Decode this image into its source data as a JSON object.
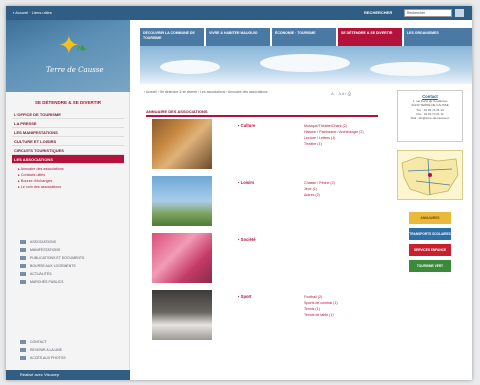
{
  "topbar": {
    "home": "▪ Accueil · Liens utiles",
    "search_label": "RECHERCHER",
    "search_value": "Rechercher"
  },
  "logo": {
    "wordmark": "Terre de Causse"
  },
  "sidebar": {
    "section_title": "SE DÉTENDRE & SE DIVERTIR",
    "menu": [
      "L'OFFICE DE TOURISME",
      "LA PRESSE",
      "LES MANIFESTATIONS",
      "CULTURE ET LOISIRS",
      "CIRCUITS TOURISTIQUES",
      "LES ASSOCIATIONS"
    ],
    "submenu": [
      "▸ Annuaire des associations",
      "▸ Contacts utiles",
      "▸ Bourse d'échanges",
      "▸ Le coin des associations"
    ],
    "links": [
      "ASSOCIATIONS",
      "MANIFESTATIONS",
      "PUBLICATIONS ET DOCUMENTS",
      "BOURSE AUX LOGEMENTS",
      "ACTUALITÉS",
      "MARCHÉS PUBLICS"
    ],
    "links2": [
      "CONTACT",
      "REVENIR A LA UNE",
      "ACCÈS AUX PHOTOS"
    ],
    "footer": "Réalisé avec Visuwep"
  },
  "nav": {
    "tabs": [
      "DÉCOUVRIR LA COMMUNE DE TOURISME",
      "VIVRE & HABITER MAUGUIO",
      "ÉCONOMIE · TOURISME",
      "SE DÉTENDRE & SE DIVERTIR",
      "LES ORGANISMES"
    ]
  },
  "main": {
    "breadcrumb": "› Accueil › Se détendre & se divertir › Les associations › Annuaire des associations",
    "tools": "A- · A A+ ⎙",
    "section_title": "ANNUAIRE DES ASSOCIATIONS",
    "categories": [
      {
        "name": "▪ Culture",
        "items": [
          "Musique/Théâtre/Chant (2)",
          "Histoire / Patrimoine / Archéologie (2)",
          "Lecture / Lettres (1)",
          "Théâtre (1)"
        ]
      },
      {
        "name": "▪ Loisirs",
        "items": [
          "Chasse / Pêche (2)",
          "Jeux (1)",
          "Autres (2)"
        ]
      },
      {
        "name": "▪ Société",
        "items": []
      },
      {
        "name": "▪ Sport",
        "items": [
          "Football (2)",
          "Sports de combat (1)",
          "Tennis (1)",
          "Tennis de table (1)"
        ]
      }
    ]
  },
  "right": {
    "contact_title": "Contact",
    "contact_lines": [
      "1, rue Porte de Coutances",
      "34130 TERRE DE CAUSSE",
      "Tél. : 04 99 74 01 10",
      "Fax : 04 99 74 01 11",
      "Mail : tdc@terre-de-causse.fr"
    ],
    "buttons": [
      "ANNUAIRES",
      "TRANSPORTS SCOLAIRES",
      "SERVICES ENFANCE",
      "TOURISME VERT"
    ]
  }
}
